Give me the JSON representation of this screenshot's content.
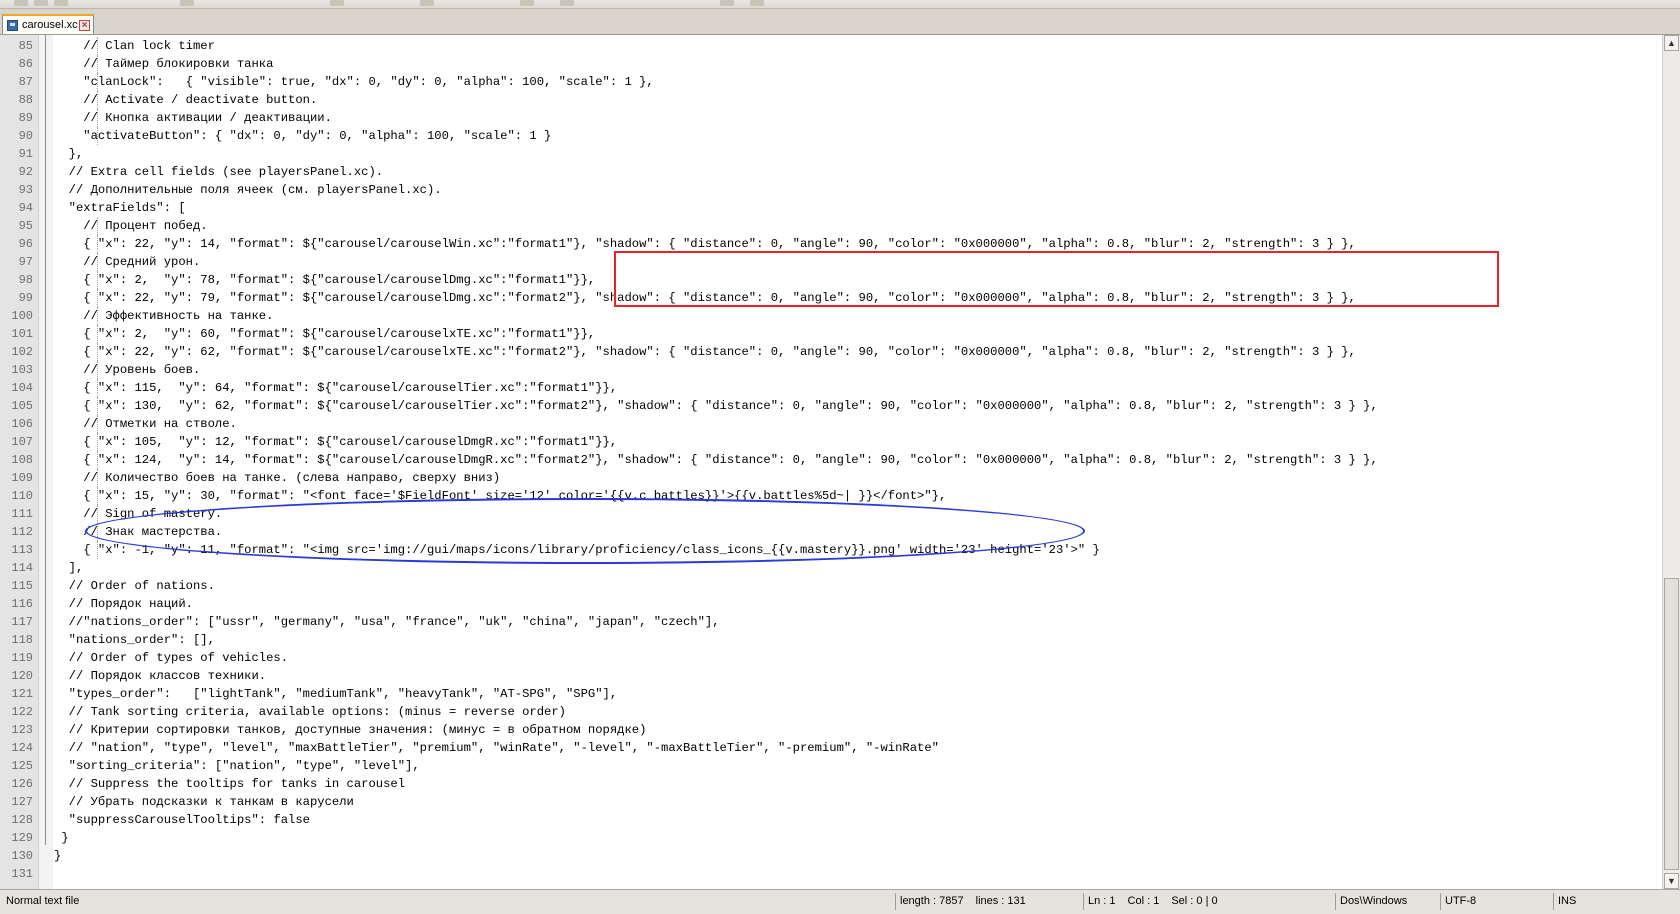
{
  "tab": {
    "title": "carousel.xc"
  },
  "lines": [
    {
      "n": "85",
      "code": "    // Clan lock timer"
    },
    {
      "n": "86",
      "code": "    // Таймер блокировки танка"
    },
    {
      "n": "87",
      "code": "    \"clanLock\":   { \"visible\": true, \"dx\": 0, \"dy\": 0, \"alpha\": 100, \"scale\": 1 },"
    },
    {
      "n": "88",
      "code": "    // Activate / deactivate button."
    },
    {
      "n": "89",
      "code": "    // Кнопка активации / деактивации."
    },
    {
      "n": "90",
      "code": "    \"activateButton\": { \"dx\": 0, \"dy\": 0, \"alpha\": 100, \"scale\": 1 }"
    },
    {
      "n": "91",
      "code": "  },"
    },
    {
      "n": "92",
      "code": "  // Extra cell fields (see playersPanel.xc)."
    },
    {
      "n": "93",
      "code": "  // Дополнительные поля ячеек (см. playersPanel.xc)."
    },
    {
      "n": "94",
      "code": "  \"extraFields\": ["
    },
    {
      "n": "95",
      "code": "    // Процент побед."
    },
    {
      "n": "96",
      "code": "    { \"x\": 22, \"y\": 14, \"format\": ${\"carousel/carouselWin.xc\":\"format1\"}, \"shadow\": { \"distance\": 0, \"angle\": 90, \"color\": \"0x000000\", \"alpha\": 0.8, \"blur\": 2, \"strength\": 3 } },"
    },
    {
      "n": "97",
      "code": "    // Средний урон."
    },
    {
      "n": "98",
      "code": "    { \"x\": 2,  \"y\": 78, \"format\": ${\"carousel/carouselDmg.xc\":\"format1\"}},"
    },
    {
      "n": "99",
      "code": "    { \"x\": 22, \"y\": 79, \"format\": ${\"carousel/carouselDmg.xc\":\"format2\"}, \"shadow\": { \"distance\": 0, \"angle\": 90, \"color\": \"0x000000\", \"alpha\": 0.8, \"blur\": 2, \"strength\": 3 } },"
    },
    {
      "n": "100",
      "code": "    // Эффективность на танке."
    },
    {
      "n": "101",
      "code": "    { \"x\": 2,  \"y\": 60, \"format\": ${\"carousel/carouselxTE.xc\":\"format1\"}},"
    },
    {
      "n": "102",
      "code": "    { \"x\": 22, \"y\": 62, \"format\": ${\"carousel/carouselxTE.xc\":\"format2\"}, \"shadow\": { \"distance\": 0, \"angle\": 90, \"color\": \"0x000000\", \"alpha\": 0.8, \"blur\": 2, \"strength\": 3 } },"
    },
    {
      "n": "103",
      "code": "    // Уровень боев."
    },
    {
      "n": "104",
      "code": "    { \"x\": 115,  \"y\": 64, \"format\": ${\"carousel/carouselTier.xc\":\"format1\"}},"
    },
    {
      "n": "105",
      "code": "    { \"x\": 130,  \"y\": 62, \"format\": ${\"carousel/carouselTier.xc\":\"format2\"}, \"shadow\": { \"distance\": 0, \"angle\": 90, \"color\": \"0x000000\", \"alpha\": 0.8, \"blur\": 2, \"strength\": 3 } },"
    },
    {
      "n": "106",
      "code": "    // Отметки на стволе."
    },
    {
      "n": "107",
      "code": "    { \"x\": 105,  \"y\": 12, \"format\": ${\"carousel/carouselDmgR.xc\":\"format1\"}},"
    },
    {
      "n": "108",
      "code": "    { \"x\": 124,  \"y\": 14, \"format\": ${\"carousel/carouselDmgR.xc\":\"format2\"}, \"shadow\": { \"distance\": 0, \"angle\": 90, \"color\": \"0x000000\", \"alpha\": 0.8, \"blur\": 2, \"strength\": 3 } },"
    },
    {
      "n": "109",
      "code": "    // Количество боев на танке. (слева направо, сверху вниз)"
    },
    {
      "n": "110",
      "code": "    { \"x\": 15, \"y\": 30, \"format\": \"<font face='$FieldFont' size='12' color='{{v.c_battles}}'>{{v.battles%5d~| }}</font>\"},"
    },
    {
      "n": "111",
      "code": "    // Sign of mastery."
    },
    {
      "n": "112",
      "code": "    // Знак мастерства."
    },
    {
      "n": "113",
      "code": "    { \"x\": -1, \"y\": 11, \"format\": \"<img src='img://gui/maps/icons/library/proficiency/class_icons_{{v.mastery}}.png' width='23' height='23'>\" }"
    },
    {
      "n": "114",
      "code": "  ],"
    },
    {
      "n": "115",
      "code": "  // Order of nations."
    },
    {
      "n": "116",
      "code": "  // Порядок наций."
    },
    {
      "n": "117",
      "code": "  //\"nations_order\": [\"ussr\", \"germany\", \"usa\", \"france\", \"uk\", \"china\", \"japan\", \"czech\"],"
    },
    {
      "n": "118",
      "code": "  \"nations_order\": [],"
    },
    {
      "n": "119",
      "code": "  // Order of types of vehicles."
    },
    {
      "n": "120",
      "code": "  // Порядок классов техники."
    },
    {
      "n": "121",
      "code": "  \"types_order\":   [\"lightTank\", \"mediumTank\", \"heavyTank\", \"AT-SPG\", \"SPG\"],"
    },
    {
      "n": "122",
      "code": "  // Tank sorting criteria, available options: (minus = reverse order)"
    },
    {
      "n": "123",
      "code": "  // Критерии сортировки танков, доступные значения: (минус = в обратном порядке)"
    },
    {
      "n": "124",
      "code": "  // \"nation\", \"type\", \"level\", \"maxBattleTier\", \"premium\", \"winRate\", \"-level\", \"-maxBattleTier\", \"-premium\", \"-winRate\""
    },
    {
      "n": "125",
      "code": "  \"sorting_criteria\": [\"nation\", \"type\", \"level\"],"
    },
    {
      "n": "126",
      "code": "  // Suppress the tooltips for tanks in carousel"
    },
    {
      "n": "127",
      "code": "  // Убрать подсказки к танкам в карусели"
    },
    {
      "n": "128",
      "code": "  \"suppressCarouselTooltips\": false"
    },
    {
      "n": "129",
      "code": " }"
    },
    {
      "n": "130",
      "code": "}"
    },
    {
      "n": "131",
      "code": ""
    }
  ],
  "status": {
    "file_type": "Normal text file",
    "length": "length : 7857",
    "lines": "lines : 131",
    "ln": "Ln : 1",
    "col": "Col : 1",
    "sel": "Sel : 0 | 0",
    "eol": "Dos\\Windows",
    "encoding": "UTF-8",
    "mode": "INS"
  },
  "colors": {
    "rect_annotation": "#e8222b",
    "ellipse_annotation": "#2b39d6",
    "active_tab_accent": "#f5a623"
  },
  "icons": [
    "document-icon",
    "close-icon",
    "scroll-up-icon",
    "scroll-down-icon"
  ]
}
